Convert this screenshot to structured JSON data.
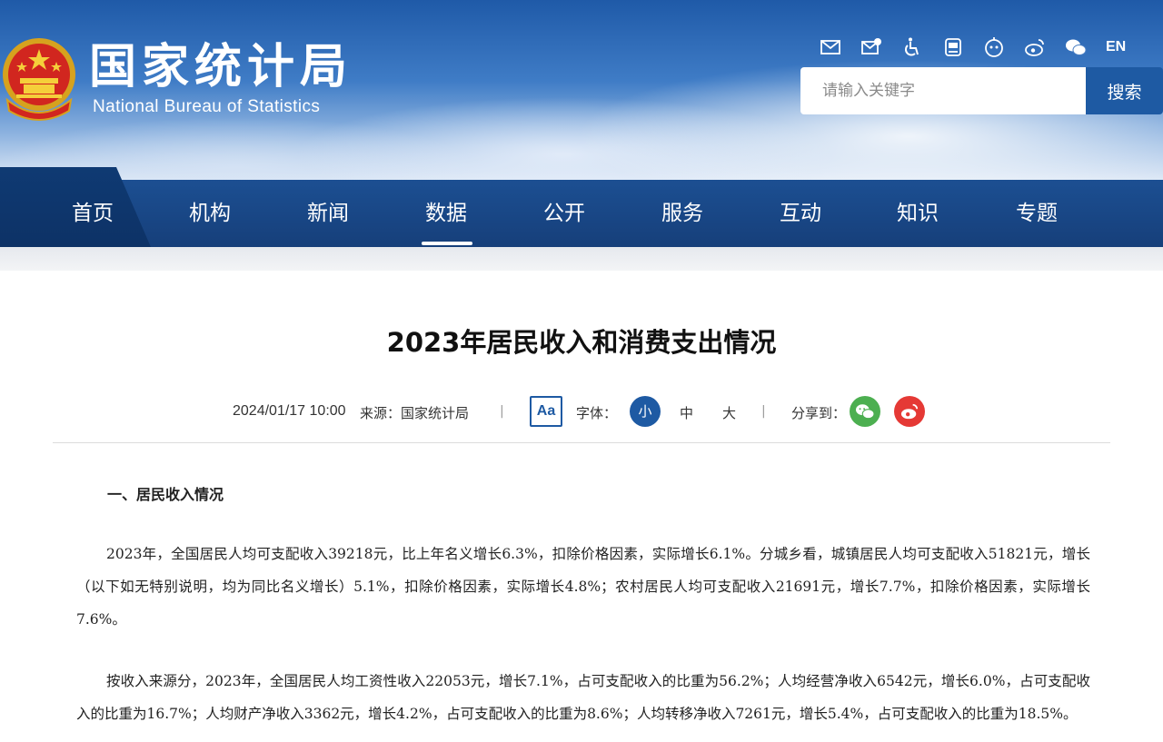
{
  "header": {
    "logo_cn": "国家统计局",
    "logo_en": "National Bureau of Statistics",
    "tools": [
      "mail-icon",
      "mail-settings-icon",
      "accessibility-icon",
      "app-icon",
      "robot-icon",
      "weibo-icon",
      "wechat-icon"
    ],
    "lang_label": "EN",
    "search_placeholder": "请输入关键字",
    "search_button": "搜索"
  },
  "nav": {
    "items": [
      {
        "label": "首页"
      },
      {
        "label": "机构"
      },
      {
        "label": "新闻"
      },
      {
        "label": "数据"
      },
      {
        "label": "公开"
      },
      {
        "label": "服务"
      },
      {
        "label": "互动"
      },
      {
        "label": "知识"
      },
      {
        "label": "专题"
      }
    ],
    "active": "数据"
  },
  "article": {
    "title": "2023年居民收入和消费支出情况",
    "date": "2024/01/17 10:00",
    "source": "来源：国家统计局",
    "aa_label": "Aa",
    "font_label": "字体：",
    "font_small": "小",
    "font_mid": "中",
    "font_big": "大",
    "share_label": "分享到：",
    "section_heading": "一、居民收入情况",
    "para1": "2023年，全国居民人均可支配收入39218元，比上年名义增长6.3%，扣除价格因素，实际增长6.1%。分城乡看，城镇居民人均可支配收入51821元，增长（以下如无特别说明，均为同比名义增长）5.1%，扣除价格因素，实际增长4.8%；农村居民人均可支配收入21691元，增长7.7%，扣除价格因素，实际增长7.6%。",
    "para2": "按收入来源分，2023年，全国居民人均工资性收入22053元，增长7.1%，占可支配收入的比重为56.2%；人均经营净收入6542元，增长6.0%，占可支配收入的比重为16.7%；人均财产净收入3362元，增长4.2%，占可支配收入的比重为8.6%；人均转移净收入7261元，增长5.4%，占可支配收入的比重为18.5%。"
  },
  "colors": {
    "brand_blue": "#1e5aa3",
    "nav_bg": "#1c4f92",
    "wechat_green": "#4caf50",
    "weibo_red": "#e53935"
  }
}
